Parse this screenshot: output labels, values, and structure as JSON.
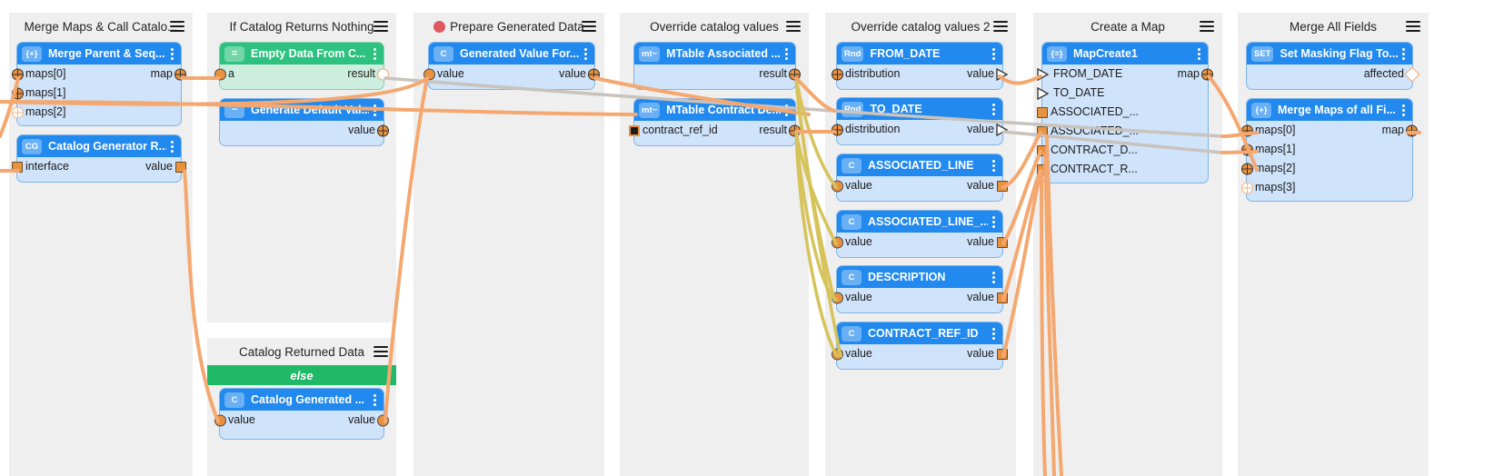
{
  "canvas": {
    "background": "#ffffff",
    "lane_background": "#efefef",
    "node_header_blue": "#2289ef",
    "node_header_green": "#2dc27f",
    "node_body_blue": "#cfe3fa",
    "else_bar_color": "#1fb967",
    "wire_orange": "#f4a870",
    "wire_olive": "#d6c35a",
    "wire_grey": "#c9c3bd"
  },
  "lanes": [
    {
      "id": "lane-merge-maps-call-catalog",
      "title": "Merge Maps & Call Catalo...",
      "menu_icon": "hamburger-icon",
      "has_status_dot": false,
      "nodes": [
        {
          "id": "node-merge-parent-seq",
          "badge": "{+}",
          "title": "Merge Parent & Seq...",
          "header_color": "blue",
          "rows": [
            {
              "in_label": "maps[0]",
              "in_port": "cross",
              "out_label": "map",
              "out_port": "cross"
            },
            {
              "in_label": "maps[1]",
              "in_port": "cross",
              "out_label": "",
              "out_port": "none"
            },
            {
              "in_label": "maps[2]",
              "in_port": "cross-hollow",
              "out_label": "",
              "out_port": "none"
            }
          ]
        },
        {
          "id": "node-catalog-generator-r",
          "badge": "CG",
          "title": "Catalog Generator R...",
          "header_color": "blue",
          "rows": [
            {
              "in_label": "interface",
              "in_port": "square",
              "out_label": "value",
              "out_port": "square"
            }
          ]
        }
      ]
    },
    {
      "id": "lane-if-catalog-returns-nothing",
      "title": "If Catalog Returns Nothing",
      "menu_icon": "hamburger-icon",
      "has_status_dot": false,
      "nodes": [
        {
          "id": "node-empty-data-from-c",
          "badge": "=",
          "title": "Empty Data From C...",
          "header_color": "green",
          "rows": [
            {
              "in_label": "a",
              "in_port": "circle",
              "out_label": "result",
              "out_port": "circle-hollow"
            }
          ]
        },
        {
          "id": "node-generate-default-val",
          "badge": "~",
          "title": "Generate Default Val...",
          "header_color": "blue",
          "rows": [
            {
              "in_label": "",
              "in_port": "none",
              "out_label": "value",
              "out_port": "cross"
            }
          ]
        }
      ]
    },
    {
      "id": "lane-catalog-returned-data",
      "title": "Catalog Returned Data",
      "menu_icon": "hamburger-icon",
      "has_status_dot": false,
      "else_label": "else",
      "nodes": [
        {
          "id": "node-catalog-generated",
          "badge": "C",
          "title": "Catalog Generated ...",
          "header_color": "blue",
          "rows": [
            {
              "in_label": "value",
              "in_port": "circle",
              "out_label": "value",
              "out_port": "circle"
            }
          ]
        }
      ]
    },
    {
      "id": "lane-prepare-generated-data",
      "title": "Prepare Generated Data",
      "menu_icon": "hamburger-icon",
      "has_status_dot": true,
      "status_dot_color": "#e0585f",
      "nodes": [
        {
          "id": "node-generated-value-for",
          "badge": "C",
          "title": "Generated Value For...",
          "header_color": "blue",
          "rows": [
            {
              "in_label": "value",
              "in_port": "circle",
              "out_label": "value",
              "out_port": "cross"
            }
          ]
        }
      ]
    },
    {
      "id": "lane-override-catalog-values",
      "title": "Override catalog values",
      "menu_icon": "hamburger-icon",
      "has_status_dot": false,
      "nodes": [
        {
          "id": "node-mtable-associated",
          "badge": "mt~",
          "title": "MTable Associated ...",
          "header_color": "blue",
          "rows": [
            {
              "in_label": "",
              "in_port": "none",
              "out_label": "result",
              "out_port": "cross"
            }
          ]
        },
        {
          "id": "node-mtable-contract-de",
          "badge": "mt~",
          "title": "MTable Contract De...",
          "header_color": "blue",
          "rows": [
            {
              "in_label": "contract_ref_id",
              "in_port": "square-dark",
              "out_label": "result",
              "out_port": "cross"
            }
          ]
        }
      ]
    },
    {
      "id": "lane-override-catalog-values-2",
      "title": "Override catalog values 2",
      "menu_icon": "hamburger-icon",
      "has_status_dot": false,
      "nodes": [
        {
          "id": "node-from-date",
          "badge": "Rnd",
          "title": "FROM_DATE",
          "header_color": "blue",
          "rows": [
            {
              "in_label": "distribution",
              "in_port": "cross",
              "out_label": "value",
              "out_port": "tri"
            }
          ]
        },
        {
          "id": "node-to-date",
          "badge": "Rnd",
          "title": "TO_DATE",
          "header_color": "blue",
          "rows": [
            {
              "in_label": "distribution",
              "in_port": "cross",
              "out_label": "value",
              "out_port": "tri"
            }
          ]
        },
        {
          "id": "node-associated-line",
          "badge": "C",
          "title": "ASSOCIATED_LINE",
          "header_color": "blue",
          "rows": [
            {
              "in_label": "value",
              "in_port": "circle",
              "out_label": "value",
              "out_port": "square"
            }
          ]
        },
        {
          "id": "node-associated-line-2",
          "badge": "C",
          "title": "ASSOCIATED_LINE_...",
          "header_color": "blue",
          "rows": [
            {
              "in_label": "value",
              "in_port": "circle",
              "out_label": "value",
              "out_port": "square"
            }
          ]
        },
        {
          "id": "node-description",
          "badge": "C",
          "title": "DESCRIPTION",
          "header_color": "blue",
          "rows": [
            {
              "in_label": "value",
              "in_port": "circle",
              "out_label": "value",
              "out_port": "square"
            }
          ]
        },
        {
          "id": "node-contract-ref-id",
          "badge": "C",
          "title": "CONTRACT_REF_ID",
          "header_color": "blue",
          "rows": [
            {
              "in_label": "value",
              "in_port": "circle",
              "out_label": "value",
              "out_port": "square"
            }
          ]
        }
      ]
    },
    {
      "id": "lane-create-a-map",
      "title": "Create a Map",
      "menu_icon": "hamburger-icon",
      "has_status_dot": false,
      "nodes": [
        {
          "id": "node-mapcreate1",
          "badge": "{=}",
          "title": "MapCreate1",
          "header_color": "blue",
          "rows": [
            {
              "in_label": "FROM_DATE",
              "in_port": "tri",
              "out_label": "map",
              "out_port": "cross"
            },
            {
              "in_label": "TO_DATE",
              "in_port": "tri",
              "out_label": "",
              "out_port": "none"
            },
            {
              "in_label": "ASSOCIATED_...",
              "in_port": "square",
              "out_label": "",
              "out_port": "none"
            },
            {
              "in_label": "ASSOCIATED_...",
              "in_port": "square",
              "out_label": "",
              "out_port": "none"
            },
            {
              "in_label": "CONTRACT_D...",
              "in_port": "square",
              "out_label": "",
              "out_port": "none"
            },
            {
              "in_label": "CONTRACT_R...",
              "in_port": "square",
              "out_label": "",
              "out_port": "none"
            }
          ]
        }
      ]
    },
    {
      "id": "lane-merge-all-fields",
      "title": "Merge All Fields",
      "menu_icon": "hamburger-icon",
      "has_status_dot": false,
      "nodes": [
        {
          "id": "node-set-masking-flag-to",
          "badge": "SET",
          "title": "Set Masking Flag To...",
          "header_color": "blue",
          "rows": [
            {
              "in_label": "",
              "in_port": "none",
              "out_label": "affected",
              "out_port": "diamond"
            }
          ]
        },
        {
          "id": "node-merge-maps-of-all-fi",
          "badge": "{+}",
          "title": "Merge Maps of all Fi...",
          "header_color": "blue",
          "rows": [
            {
              "in_label": "maps[0]",
              "in_port": "cross",
              "out_label": "map",
              "out_port": "cross"
            },
            {
              "in_label": "maps[1]",
              "in_port": "cross",
              "out_label": "",
              "out_port": "none"
            },
            {
              "in_label": "maps[2]",
              "in_port": "cross",
              "out_label": "",
              "out_port": "none"
            },
            {
              "in_label": "maps[3]",
              "in_port": "cross-hollow",
              "out_label": "",
              "out_port": "none"
            }
          ]
        }
      ]
    }
  ]
}
